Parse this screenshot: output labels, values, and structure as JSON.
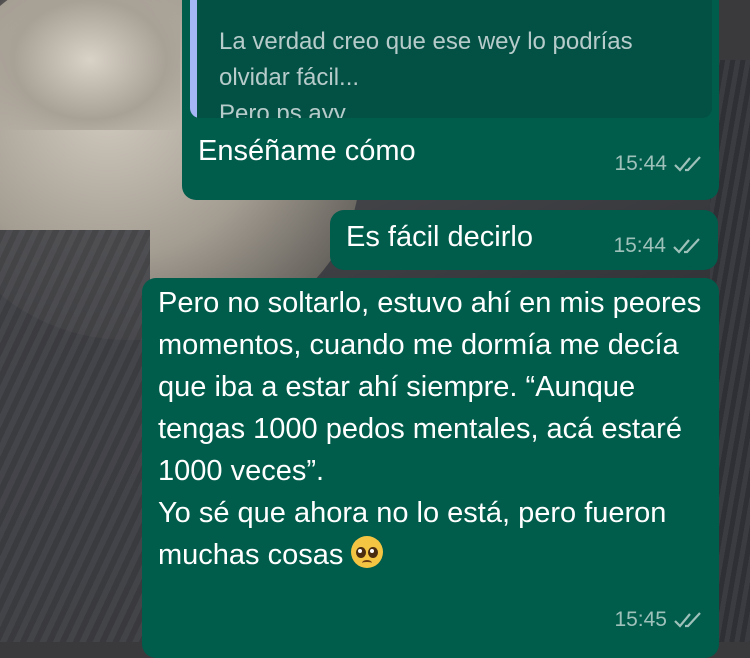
{
  "conversation": {
    "messages": [
      {
        "id": "m1",
        "quoted_text": "La verdad creo que ese wey lo podrías\nolvidar fácil...\nPero ps ayy...",
        "text": "Enséñame cómo",
        "time": "15:44",
        "status": "read"
      },
      {
        "id": "m2",
        "text": "Es fácil decirlo",
        "time": "15:44",
        "status": "read"
      },
      {
        "id": "m3",
        "text": "Pero no soltarlo, estuvo ahí en mis peores momentos, cuando me dormía me decía que iba a estar ahí siempre. “Aunque tengas 1000 pedos mentales, acá estaré 1000 veces”.\nYo sé que ahora no lo está, pero fueron muchas cosas",
        "emoji": "pleading-face",
        "time": "15:45",
        "status": "read"
      }
    ]
  },
  "colors": {
    "outgoing_bubble": "#005c4b",
    "quote_bar": "#a5b6f6"
  }
}
